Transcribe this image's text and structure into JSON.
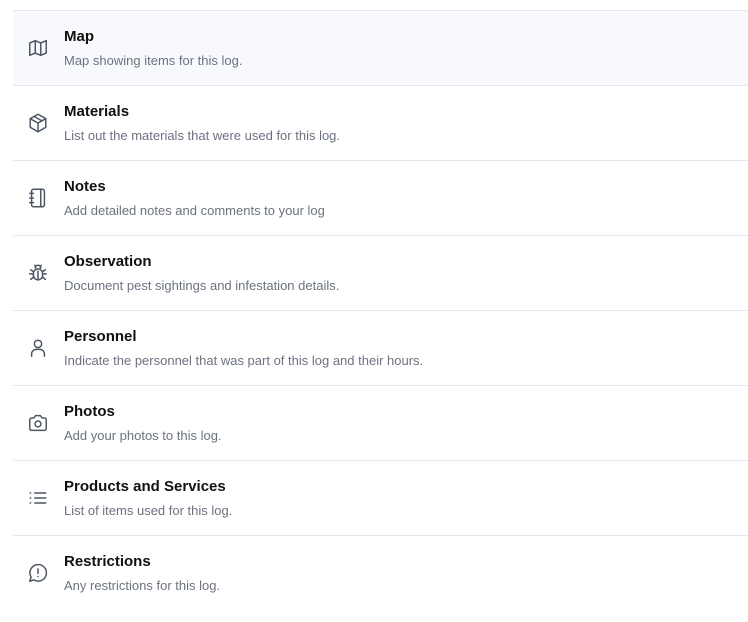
{
  "items": [
    {
      "title": "Map",
      "description": "Map showing items for this log.",
      "icon": "map-icon"
    },
    {
      "title": "Materials",
      "description": "List out the materials that were used for this log.",
      "icon": "package-icon"
    },
    {
      "title": "Notes",
      "description": "Add detailed notes and comments to your log",
      "icon": "notebook-icon"
    },
    {
      "title": "Observation",
      "description": "Document pest sightings and infestation details.",
      "icon": "bug-icon"
    },
    {
      "title": "Personnel",
      "description": "Indicate the personnel that was part of this log and their hours.",
      "icon": "user-icon"
    },
    {
      "title": "Photos",
      "description": "Add your photos to this log.",
      "icon": "camera-icon"
    },
    {
      "title": "Products and Services",
      "description": "List of items used for this log.",
      "icon": "list-icon"
    },
    {
      "title": "Restrictions",
      "description": "Any restrictions for this log.",
      "icon": "message-alert-icon"
    }
  ],
  "colors": {
    "active_row_bg": "#f8f9fc",
    "divider": "#e5e7eb",
    "title": "#111111",
    "description": "#6b7280",
    "icon": "#4b5563"
  }
}
